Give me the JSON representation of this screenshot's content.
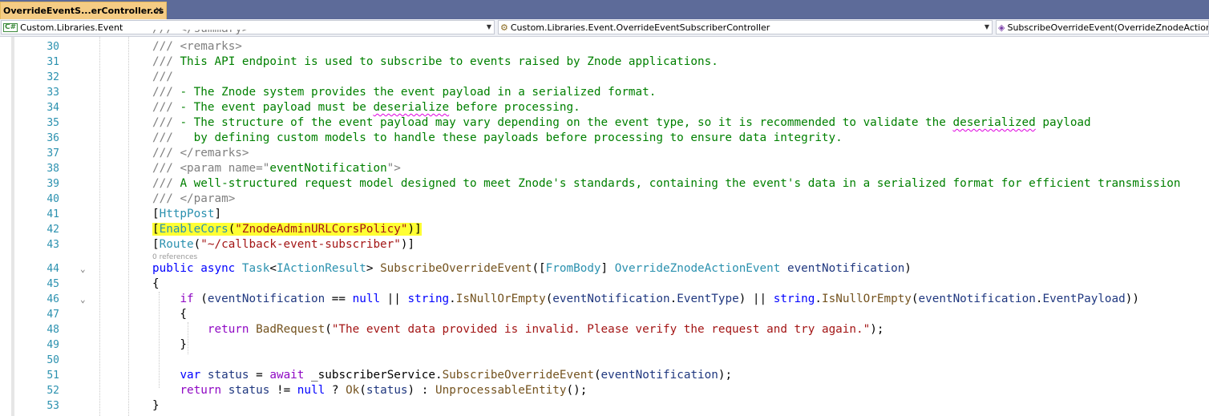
{
  "tab": {
    "title": "OverrideEventS...erController.cs",
    "close": "✕"
  },
  "nav": {
    "project": "Custom.Libraries.Event",
    "type": "Custom.Libraries.Event.OverrideEventSubscriberController",
    "member": "SubscribeOverrideEvent(OverrideZnodeActionEv"
  },
  "codelens": "0 references",
  "lines": [
    {
      "n": "30",
      "parts": [
        [
          "x",
          "/// "
        ],
        [
          "x",
          "<remarks>"
        ]
      ]
    },
    {
      "n": "31",
      "parts": [
        [
          "x",
          "/// "
        ],
        [
          "c",
          "This API endpoint is used to subscribe to events raised by Znode applications."
        ]
      ]
    },
    {
      "n": "32",
      "parts": [
        [
          "x",
          "///"
        ]
      ]
    },
    {
      "n": "33",
      "parts": [
        [
          "x",
          "/// "
        ],
        [
          "c",
          "- The Znode system provides the event payload in a serialized format."
        ]
      ]
    },
    {
      "n": "34",
      "parts": [
        [
          "x",
          "/// "
        ],
        [
          "c",
          "- The event payload must be "
        ],
        [
          "c sq",
          "deserialize"
        ],
        [
          "c",
          " before processing."
        ]
      ]
    },
    {
      "n": "35",
      "parts": [
        [
          "x",
          "/// "
        ],
        [
          "c",
          "- The structure of the event payload may vary depending on the event type, so it is recommended to validate the "
        ],
        [
          "c sq",
          "deserialized"
        ],
        [
          "c",
          " payload"
        ]
      ]
    },
    {
      "n": "36",
      "parts": [
        [
          "x",
          "/// "
        ],
        [
          "c",
          "  by defining custom models to handle these payloads before processing to ensure data integrity."
        ]
      ]
    },
    {
      "n": "37",
      "parts": [
        [
          "x",
          "/// "
        ],
        [
          "x",
          "</remarks>"
        ]
      ]
    },
    {
      "n": "38",
      "parts": [
        [
          "x",
          "/// "
        ],
        [
          "x",
          "<param name=\""
        ],
        [
          "c",
          "eventNotification"
        ],
        [
          "x",
          "\">"
        ]
      ]
    },
    {
      "n": "39",
      "parts": [
        [
          "x",
          "/// "
        ],
        [
          "c",
          "A well-structured request model designed to meet Znode's standards, containing the event's data in a serialized format for efficient transmission"
        ]
      ]
    },
    {
      "n": "40",
      "parts": [
        [
          "x",
          "/// "
        ],
        [
          "x",
          "</param>"
        ]
      ]
    },
    {
      "n": "41",
      "parts": [
        [
          "p",
          "["
        ],
        [
          "t",
          "HttpPost"
        ],
        [
          "p",
          "]"
        ]
      ]
    },
    {
      "n": "42",
      "parts": [
        [
          "p hl",
          "["
        ],
        [
          "t hl",
          "EnableCors"
        ],
        [
          "p hl",
          "("
        ],
        [
          "s hl",
          "\"ZnodeAdminURLCorsPolicy\""
        ],
        [
          "p hl",
          ")]"
        ]
      ]
    },
    {
      "n": "43",
      "parts": [
        [
          "p",
          "["
        ],
        [
          "t",
          "Route"
        ],
        [
          "p",
          "("
        ],
        [
          "s",
          "\"~/callback-event-subscriber\""
        ],
        [
          "p",
          ")]"
        ]
      ]
    },
    {
      "n": "44",
      "parts": [
        [
          "k",
          "public async "
        ],
        [
          "t",
          "Task"
        ],
        [
          "p",
          "<"
        ],
        [
          "t",
          "IActionResult"
        ],
        [
          "p",
          "> "
        ],
        [
          "m",
          "SubscribeOverrideEvent"
        ],
        [
          "p",
          "(["
        ],
        [
          "t",
          "FromBody"
        ],
        [
          "p",
          "] "
        ],
        [
          "t",
          "OverrideZnodeActionEvent"
        ],
        [
          "p",
          " "
        ],
        [
          "v",
          "eventNotification"
        ],
        [
          "p",
          ")"
        ]
      ]
    },
    {
      "n": "45",
      "parts": [
        [
          "p",
          "{"
        ]
      ]
    },
    {
      "n": "46",
      "parts": [
        [
          "p",
          "    "
        ],
        [
          "kc",
          "if"
        ],
        [
          "p",
          " ("
        ],
        [
          "v",
          "eventNotification"
        ],
        [
          "p",
          " == "
        ],
        [
          "k",
          "null"
        ],
        [
          "p",
          " || "
        ],
        [
          "k",
          "string"
        ],
        [
          "p",
          "."
        ],
        [
          "m",
          "IsNullOrEmpty"
        ],
        [
          "p",
          "("
        ],
        [
          "v",
          "eventNotification"
        ],
        [
          "p",
          "."
        ],
        [
          "v",
          "EventType"
        ],
        [
          "p",
          ") || "
        ],
        [
          "k",
          "string"
        ],
        [
          "p",
          "."
        ],
        [
          "m",
          "IsNullOrEmpty"
        ],
        [
          "p",
          "("
        ],
        [
          "v",
          "eventNotification"
        ],
        [
          "p",
          "."
        ],
        [
          "v",
          "EventPayload"
        ],
        [
          "p",
          "))"
        ]
      ]
    },
    {
      "n": "47",
      "parts": [
        [
          "p",
          "    {"
        ]
      ]
    },
    {
      "n": "48",
      "parts": [
        [
          "p",
          "        "
        ],
        [
          "kc",
          "return"
        ],
        [
          "p",
          " "
        ],
        [
          "m",
          "BadRequest"
        ],
        [
          "p",
          "("
        ],
        [
          "s",
          "\"The event data provided is invalid. Please verify the request and try again.\""
        ],
        [
          "p",
          ");"
        ]
      ]
    },
    {
      "n": "49",
      "parts": [
        [
          "p",
          "    }"
        ]
      ]
    },
    {
      "n": "50",
      "parts": [
        [
          "p",
          ""
        ]
      ]
    },
    {
      "n": "51",
      "parts": [
        [
          "p",
          "    "
        ],
        [
          "k",
          "var"
        ],
        [
          "p",
          " "
        ],
        [
          "v",
          "status"
        ],
        [
          "p",
          " = "
        ],
        [
          "kc",
          "await"
        ],
        [
          "p",
          " _subscriberService."
        ],
        [
          "m",
          "SubscribeOverrideEvent"
        ],
        [
          "p",
          "("
        ],
        [
          "v",
          "eventNotification"
        ],
        [
          "p",
          ");"
        ]
      ]
    },
    {
      "n": "52",
      "parts": [
        [
          "p",
          "    "
        ],
        [
          "kc",
          "return"
        ],
        [
          "p",
          " "
        ],
        [
          "v",
          "status"
        ],
        [
          "p",
          " != "
        ],
        [
          "k",
          "null"
        ],
        [
          "p",
          " ? "
        ],
        [
          "m",
          "Ok"
        ],
        [
          "p",
          "("
        ],
        [
          "v",
          "status"
        ],
        [
          "p",
          ") : "
        ],
        [
          "m",
          "UnprocessableEntity"
        ],
        [
          "p",
          "();"
        ]
      ]
    },
    {
      "n": "53",
      "parts": [
        [
          "p",
          "}"
        ]
      ]
    }
  ],
  "folds": {
    "44": "⌄",
    "46": "⌄"
  }
}
